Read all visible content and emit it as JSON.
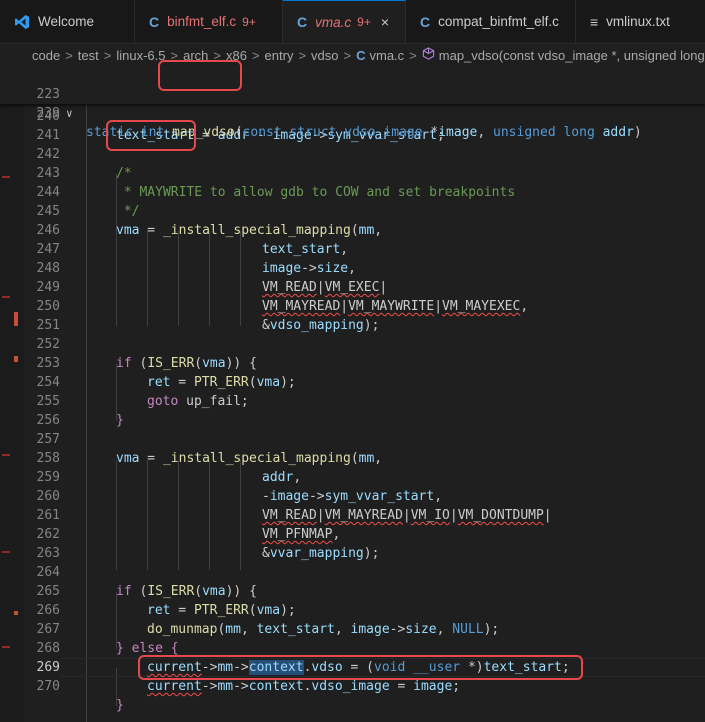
{
  "tabs": [
    {
      "icon": "vscode-icon",
      "label": "Welcome",
      "modified": "",
      "closable": false,
      "active": false
    },
    {
      "icon": "C",
      "label": "binfmt_elf.c",
      "modified": "9+",
      "closable": false,
      "active": false
    },
    {
      "icon": "C",
      "label": "vma.c",
      "modified": "9+",
      "closable": true,
      "close": "×",
      "active": true
    },
    {
      "icon": "C",
      "label": "compat_binfmt_elf.c",
      "modified": "",
      "closable": false,
      "active": false
    },
    {
      "icon": "≡",
      "label": "vmlinux.txt",
      "modified": "",
      "closable": false,
      "active": false
    }
  ],
  "breadcrumbs": {
    "items": [
      "code",
      "test",
      "linux-6.5",
      "arch",
      "x86",
      "entry",
      "vdso"
    ],
    "file_icon": "C",
    "file": "vma.c",
    "symbol": "map_vdso(const vdso_image *, unsigned long)",
    "separator": ">"
  },
  "colors": {
    "highlight_box": "#e5484d",
    "tab_accent": "#0078d4",
    "keyword": "#569cd6",
    "function": "#dcdcaa",
    "variable": "#9cdcfe",
    "comment": "#6a9955",
    "control": "#c586c0"
  },
  "sticky": {
    "line223": {
      "num": "223",
      "fold": "∨"
    },
    "line239": {
      "num": "239"
    }
  },
  "code": {
    "l240": {
      "num": "240"
    },
    "l241": {
      "num": "241"
    },
    "l242": {
      "num": "242"
    },
    "l243": {
      "num": "243"
    },
    "l244": {
      "num": "244"
    },
    "l245": {
      "num": "245"
    },
    "l246": {
      "num": "246"
    },
    "l247": {
      "num": "247"
    },
    "l248": {
      "num": "248"
    },
    "l249": {
      "num": "249"
    },
    "l250": {
      "num": "250"
    },
    "l251": {
      "num": "251"
    },
    "l252": {
      "num": "252"
    },
    "l253": {
      "num": "253"
    },
    "l254": {
      "num": "254"
    },
    "l255": {
      "num": "255"
    },
    "l256": {
      "num": "256"
    },
    "l257": {
      "num": "257"
    },
    "l258": {
      "num": "258"
    },
    "l259": {
      "num": "259"
    },
    "l260": {
      "num": "260"
    },
    "l261": {
      "num": "261"
    },
    "l262": {
      "num": "262"
    },
    "l263": {
      "num": "263"
    },
    "l264": {
      "num": "264"
    },
    "l265": {
      "num": "265"
    },
    "l266": {
      "num": "266"
    },
    "l267": {
      "num": "267"
    },
    "l268": {
      "num": "268"
    },
    "l269": {
      "num": "269"
    },
    "l270": {
      "num": "270"
    }
  }
}
